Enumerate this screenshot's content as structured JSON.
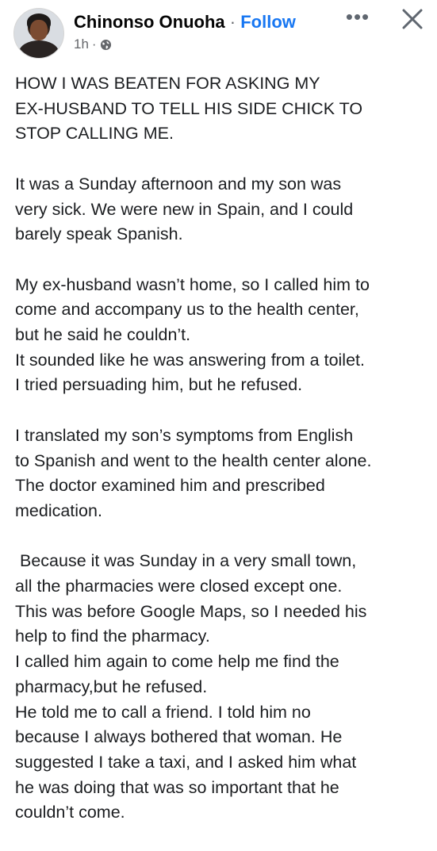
{
  "header": {
    "author_name": "Chinonso Onuoha",
    "separator": " · ",
    "follow_label": "Follow",
    "time": "1h",
    "meta_separator": "·",
    "more_label": "•••",
    "privacy_icon": "globe-icon",
    "close_icon": "close-icon"
  },
  "post": {
    "paragraphs": [
      "HOW I WAS BEATEN FOR ASKING MY\nEX-HUSBAND TO TELL HIS SIDE CHICK TO\nSTOP CALLING ME.",
      "It was a Sunday afternoon and my son was\nvery sick. We were new in Spain, and I could\nbarely speak Spanish.",
      "My ex-husband wasn’t home, so I called him to\ncome and accompany us to the health center,\nbut he said he couldn’t.\nIt sounded like he was answering from a toilet.\nI tried persuading him, but he refused.",
      "I translated my son’s symptoms from English\nto Spanish and went to the health center alone.\nThe doctor examined him and prescribed\nmedication.",
      " Because it was Sunday in a very small town,\nall the pharmacies were closed except one.\nThis was before Google Maps, so I needed his\nhelp to find the pharmacy.\nI called him again to come help me find the\npharmacy,but he refused.\nHe told me to call a friend. I told him no\nbecause I always bothered that woman. He\nsuggested I take a taxi, and I asked him what\nhe was doing that was so important that he\ncouldn’t come."
    ]
  }
}
